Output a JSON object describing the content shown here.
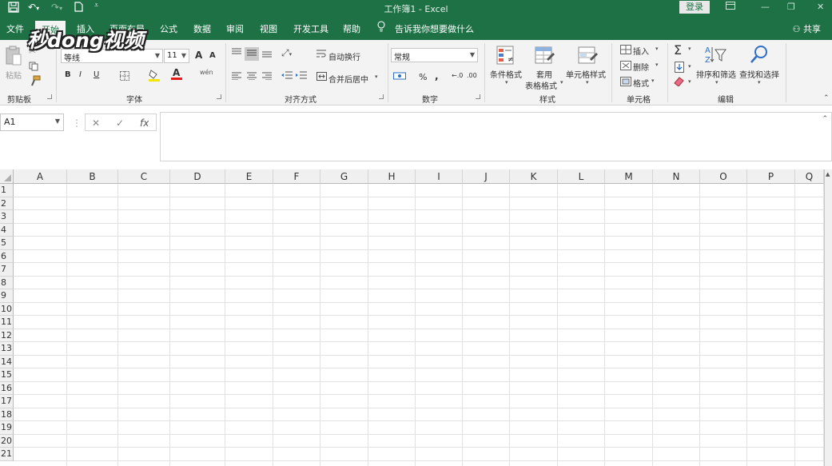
{
  "window": {
    "title": "工作簿1 - Excel",
    "login": "登录"
  },
  "menu": {
    "tabs": [
      "文件",
      "开始",
      "插入",
      "页面布局",
      "公式",
      "数据",
      "审阅",
      "视图",
      "开发工具",
      "帮助"
    ],
    "tell_me": "告诉我你想要做什么",
    "share": "共享"
  },
  "watermark": "秒dong视频",
  "ribbon": {
    "clipboard": {
      "paste": "粘贴",
      "group": "剪贴板"
    },
    "font": {
      "name": "等线",
      "size": "11",
      "bold": "B",
      "italic": "I",
      "underline": "U",
      "grow": "A",
      "shrink": "A",
      "font_color_label": "A",
      "phonetic": "wén",
      "group": "字体"
    },
    "alignment": {
      "wrap": "自动换行",
      "merge": "合并后居中",
      "group": "对齐方式"
    },
    "number": {
      "format": "常规",
      "percent": "%",
      "comma": ",",
      "group": "数字"
    },
    "styles": {
      "conditional": "条件格式",
      "table_line1": "套用",
      "table_line2": "表格格式",
      "cell": "单元格样式",
      "group": "样式"
    },
    "cells": {
      "insert": "插入",
      "delete": "删除",
      "format": "格式",
      "group": "单元格"
    },
    "editing": {
      "sigma": "Σ",
      "sort": "排序和筛选",
      "find": "查找和选择",
      "group": "编辑"
    }
  },
  "formula_bar": {
    "name_box": "A1",
    "fx": "fx",
    "cancel": "✕",
    "enter": "✓",
    "value": ""
  },
  "grid": {
    "columns": [
      "A",
      "B",
      "C",
      "D",
      "E",
      "F",
      "G",
      "H",
      "I",
      "J",
      "K",
      "L",
      "M",
      "N",
      "O",
      "P",
      "Q"
    ],
    "rows": [
      "1",
      "2",
      "3",
      "4",
      "5",
      "6",
      "7",
      "8",
      "9",
      "10",
      "11",
      "12",
      "13",
      "14",
      "15",
      "16",
      "17",
      "18",
      "19",
      "20",
      "21"
    ]
  }
}
